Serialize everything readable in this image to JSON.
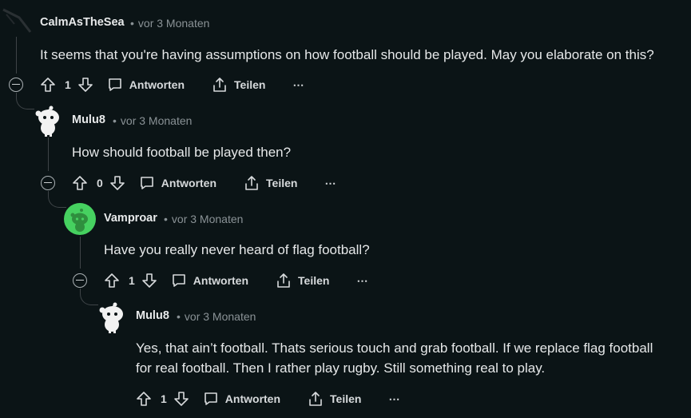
{
  "comments": [
    {
      "username": "CalmAsTheSea",
      "time": "vor 3 Monaten",
      "lines": [
        "It seems that you're having assumptions on how football should be played. May you elaborate on this?"
      ],
      "votes": "1",
      "reply_label": "Antworten",
      "share_label": "Teilen",
      "avatar": "dark-avatar-icon"
    },
    {
      "username": "Mulu8",
      "time": "vor 3 Monaten",
      "lines": [
        "How should football be played then?"
      ],
      "votes": "0",
      "reply_label": "Antworten",
      "share_label": "Teilen",
      "avatar": "snoo-white-icon"
    },
    {
      "username": "Vamproar",
      "time": "vor 3 Monaten",
      "lines": [
        "Have you really never heard of flag football?"
      ],
      "votes": "1",
      "reply_label": "Antworten",
      "share_label": "Teilen",
      "avatar": "snoo-green-icon"
    },
    {
      "username": "Mulu8",
      "time": "vor 3 Monaten",
      "lines": [
        "Yes, that ain’t football. Thats serious touch and grab football. If we replace flag football",
        "for real football. Then I rather play rugby. Still something real to play."
      ],
      "votes": "1",
      "reply_label": "Antworten",
      "share_label": "Teilen",
      "avatar": "snoo-white-icon"
    }
  ],
  "colors": {
    "background": "#0b1416",
    "thread_line": "#3e4447",
    "avatar_green": "#46d160"
  },
  "dot": "•",
  "more": "⋯"
}
